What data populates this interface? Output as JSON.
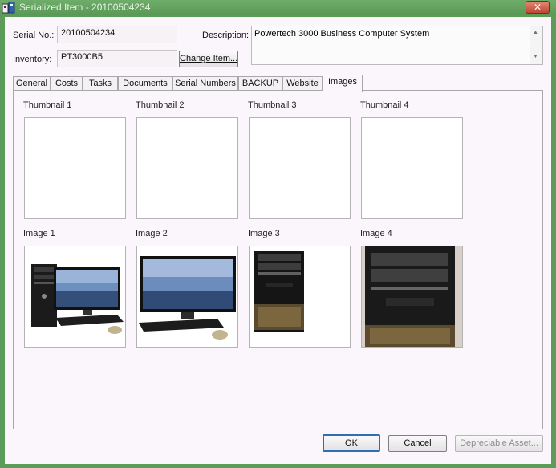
{
  "window": {
    "title": "Serialized Item - 20100504234",
    "close_label": "✕"
  },
  "fields": {
    "serial_label": "Serial No.:",
    "serial_value": "20100504234",
    "inventory_label": "Inventory:",
    "inventory_value": "PT3000B5",
    "change_item_label": "Change Item...",
    "description_label": "Description:",
    "description_value": "Powertech 3000 Business Computer System"
  },
  "tabs": [
    {
      "label": "General"
    },
    {
      "label": "Costs"
    },
    {
      "label": "Tasks"
    },
    {
      "label": "Documents"
    },
    {
      "label": "Serial Numbers"
    },
    {
      "label": "BACKUP"
    },
    {
      "label": "Website"
    },
    {
      "label": "Images",
      "active": true
    }
  ],
  "thumbnails": [
    {
      "label": "Thumbnail 1"
    },
    {
      "label": "Thumbnail 2"
    },
    {
      "label": "Thumbnail 3"
    },
    {
      "label": "Thumbnail 4"
    }
  ],
  "images": [
    {
      "label": "Image 1",
      "content": "computer-system-photo"
    },
    {
      "label": "Image 2",
      "content": "monitor-keyboard-mouse-photo"
    },
    {
      "label": "Image 3",
      "content": "tower-photo"
    },
    {
      "label": "Image 4",
      "content": "tower-closeup-photo"
    }
  ],
  "footer": {
    "ok_label": "OK",
    "cancel_label": "Cancel",
    "depreciable_label": "Depreciable Asset..."
  },
  "colors": {
    "titlebar": "#5d9b59",
    "client": "#fbf6fb",
    "default_button_border": "#2d6fb0"
  }
}
